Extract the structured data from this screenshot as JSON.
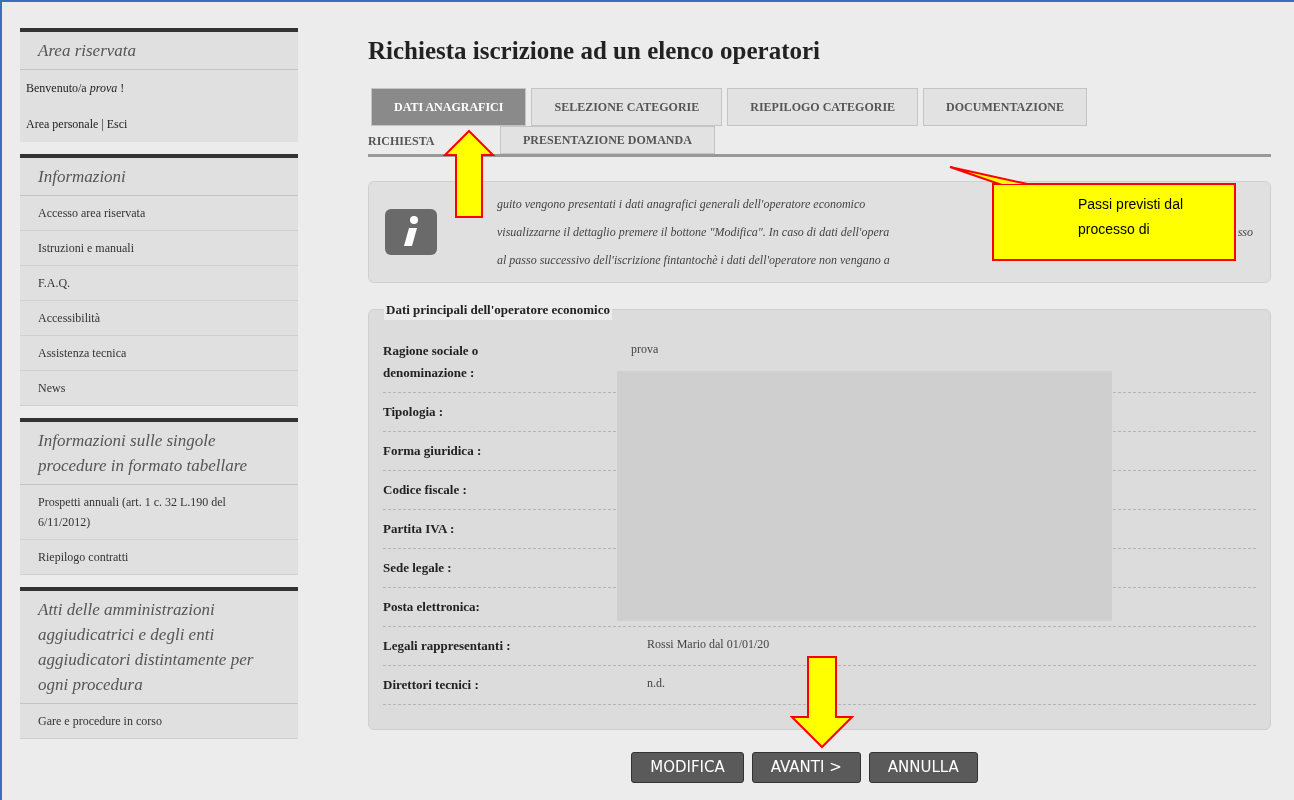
{
  "sidebar": {
    "sections": [
      {
        "title": "Area riservata",
        "kind": "login",
        "items": [
          "Benvenuto/a *prova* !",
          "Area personale | Esci"
        ]
      },
      {
        "title": "Informazioni",
        "kind": "menu",
        "items": [
          "Accesso area riservata",
          "Istruzioni e manuali",
          "F.A.Q.",
          "Accessibilità",
          "Assistenza tecnica",
          "News"
        ]
      },
      {
        "title": "Informazioni sulle singole procedure in formato tabellare",
        "kind": "menu",
        "items": [
          "Prospetti annuali (art. 1 c. 32 L.190 del 6/11/2012)",
          "Riepilogo contratti"
        ]
      },
      {
        "title": "Atti delle amministrazioni aggiudicatrici e degli enti aggiudicatori distintamente per ogni procedura",
        "kind": "menu",
        "items": [
          "Gare e procedure in corso"
        ]
      }
    ]
  },
  "main": {
    "title": "Richiesta iscrizione ad un elenco operatori",
    "tab_rows": [
      [
        {
          "label": "DATI ANAGRAFICI",
          "selected": true,
          "kind": "tab"
        },
        {
          "label": "SELEZIONE CATEGORIE",
          "selected": false,
          "kind": "tab"
        },
        {
          "label": "RIEPILOGO CATEGORIE",
          "selected": false,
          "kind": "tab"
        },
        {
          "label": "DOCUMENTAZIONE",
          "selected": false,
          "kind": "tab"
        }
      ],
      [
        {
          "label": "RICHIESTA",
          "selected": false,
          "kind": "continuation"
        },
        {
          "label": "PRESENTAZIONE DOMANDA",
          "selected": false,
          "kind": "tab"
        }
      ]
    ],
    "info": {
      "lines": [
        [
          "guito vengono presentati i dati anagrafici generali dell'operatore economico"
        ],
        [
          "visualizzarne il dettaglio premere il bottone \"Modifica\". In caso di dati dell'opera",
          "sso"
        ],
        [
          "al passo successivo dell'iscrizione fintantochè i dati dell'operatore non vengano a"
        ]
      ]
    },
    "data_section": {
      "legend": "Dati principali dell'operatore economico",
      "rows": [
        {
          "label": "Ragione sociale o denominazione :",
          "value": "prova"
        },
        {
          "label": "Tipologia :"
        },
        {
          "label": "Forma giuridica :"
        },
        {
          "label": "Codice fiscale :"
        },
        {
          "label": "Partita IVA :"
        },
        {
          "label": "Sede legale :"
        },
        {
          "label": "Posta elettronica:"
        },
        {
          "label": "Legali rappresentanti :",
          "value": "Rossi Mario dal 01/01/20"
        },
        {
          "label": "Direttori tecnici :",
          "value": "n.d."
        }
      ],
      "redacted": true
    },
    "buttons": [
      "MODIFICA",
      "AVANTI >",
      "ANNULLA"
    ]
  },
  "annotations": [
    {
      "kind": "arrow-up"
    },
    {
      "kind": "arrow-down"
    },
    {
      "kind": "callout",
      "text": "Passi previsti dal processo di"
    }
  ]
}
